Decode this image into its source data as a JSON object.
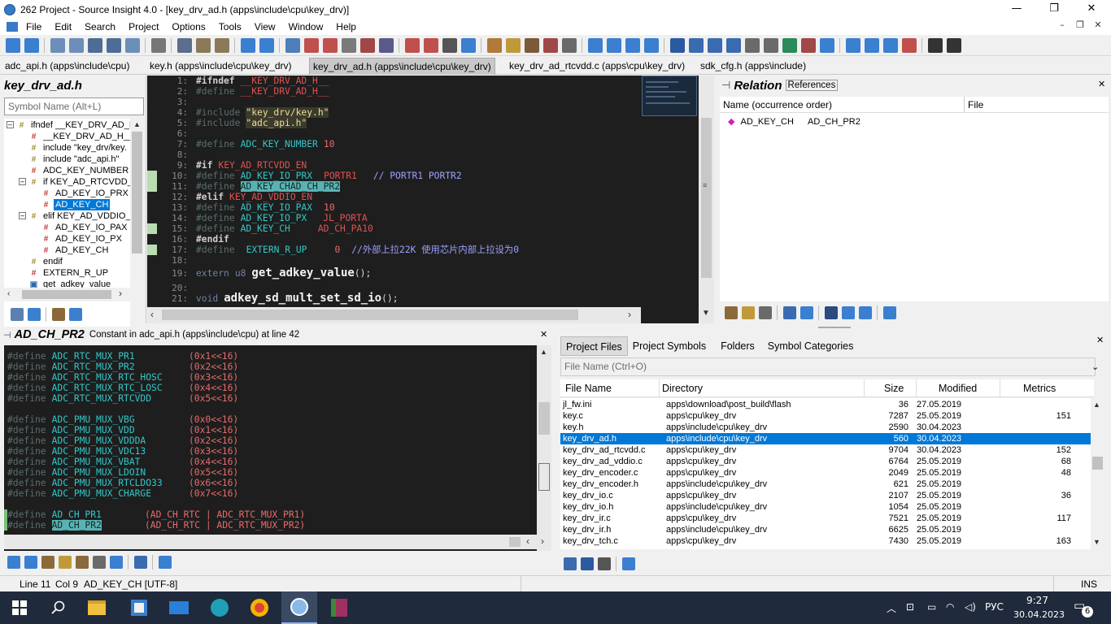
{
  "window": {
    "title": "262 Project - Source Insight 4.0 - [key_drv_ad.h (apps\\include\\cpu\\key_drv)]"
  },
  "menu": [
    "File",
    "Edit",
    "Search",
    "Project",
    "Options",
    "Tools",
    "View",
    "Window",
    "Help"
  ],
  "tabs": [
    "adc_api.h (apps\\include\\cpu)",
    "key.h (apps\\include\\cpu\\key_drv)",
    "key_drv_ad.h (apps\\include\\cpu\\key_drv)",
    "key_drv_ad_rtcvdd.c (apps\\cpu\\key_drv)",
    "sdk_cfg.h (apps\\include)"
  ],
  "symbol_window": {
    "title": "key_drv_ad.h",
    "search_placeholder": "Symbol Name (Alt+L)",
    "items": [
      "ifndef __KEY_DRV_AD_H",
      "__KEY_DRV_AD_H__",
      "include \"key_drv/key.",
      "include \"adc_api.h\"",
      "ADC_KEY_NUMBER",
      "if KEY_AD_RTCVDD_E",
      "AD_KEY_IO_PRX",
      "AD_KEY_CH",
      "elif KEY_AD_VDDIO_E",
      "AD_KEY_IO_PAX",
      "AD_KEY_IO_PX",
      "AD_KEY_CH",
      "endif",
      "EXTERN_R_UP",
      "get_adkey_value"
    ]
  },
  "editor": {
    "line_numbers": [
      "1:",
      "2:",
      "3:",
      "4:",
      "5:",
      "6:",
      "7:",
      "8:",
      "9:",
      "10:",
      "11:",
      "12:",
      "13:",
      "14:",
      "15:",
      "16:",
      "17:",
      "18:",
      "19:",
      "20:",
      "21:"
    ],
    "l1a": "#ifndef",
    "l1b": "__KEY_DRV_AD_H__",
    "l2a": "#define",
    "l2b": "__KEY_DRV_AD_H__",
    "l4a": "#include",
    "l4b": "\"key_drv/key.h\"",
    "l5a": "#include",
    "l5b": "\"adc_api.h\"",
    "l7a": "#define",
    "l7b": "ADC_KEY_NUMBER",
    "l7c": "10",
    "l9a": "#if",
    "l9b": "KEY_AD_RTCVDD_EN",
    "l10a": "#define",
    "l10b": "AD_KEY_IO_PRX",
    "l10c": "PORTR1",
    "l10d": "// PORTR1 PORTR2",
    "l11a": "#define",
    "l11b": "AD_KEY_CH",
    "l11c": "AD_CH_PR2",
    "l12a": "#elif",
    "l12b": "KEY_AD_VDDIO_EN",
    "l13a": "#define",
    "l13b": "AD_KEY_IO_PAX",
    "l13c": "10",
    "l14a": "#define",
    "l14b": "AD_KEY_IO_PX",
    "l14c": "JL_PORTA",
    "l15a": "#define",
    "l15b": "AD_KEY_CH",
    "l15c": "AD_CH_PA10",
    "l16a": "#endif",
    "l17a": "#define",
    "l17b": "EXTERN_R_UP",
    "l17c": "0",
    "l17d": "//外部上拉22K 使用芯片内部上拉设为0",
    "l19a": "extern",
    "l19b": "u8",
    "l19c": "get_adkey_value",
    "l19d": "();",
    "l21a": "void",
    "l21b": "adkey_sd_mult_set_sd_io",
    "l21c": "();"
  },
  "relation": {
    "title": "Relation",
    "tab": "References",
    "col_name": "Name (occurrence order)",
    "col_file": "File",
    "row_name": "AD_KEY_CH",
    "row_ref": "AD_CH_PR2"
  },
  "context": {
    "symbol": "AD_CH_PR2",
    "desc": "Constant in adc_api.h (apps\\include\\cpu) at line 42",
    "rows": [
      {
        "d": "#define",
        "n": "ADC_RTC_MUX_PR1",
        "v": "(0x1<<16)"
      },
      {
        "d": "#define",
        "n": "ADC_RTC_MUX_PR2",
        "v": "(0x2<<16)"
      },
      {
        "d": "#define",
        "n": "ADC_RTC_MUX_RTC_HOSC",
        "v": "(0x3<<16)"
      },
      {
        "d": "#define",
        "n": "ADC_RTC_MUX_RTC_LOSC",
        "v": "(0x4<<16)"
      },
      {
        "d": "#define",
        "n": "ADC_RTC_MUX_RTCVDD",
        "v": "(0x5<<16)"
      },
      {
        "d": "#define",
        "n": "ADC_PMU_MUX_VBG",
        "v": "(0x0<<16)"
      },
      {
        "d": "#define",
        "n": "ADC_PMU_MUX_VDD",
        "v": "(0x1<<16)"
      },
      {
        "d": "#define",
        "n": "ADC_PMU_MUX_VDDDA",
        "v": "(0x2<<16)"
      },
      {
        "d": "#define",
        "n": "ADC_PMU_MUX_VDC13",
        "v": "(0x3<<16)"
      },
      {
        "d": "#define",
        "n": "ADC_PMU_MUX_VBAT",
        "v": "(0x4<<16)"
      },
      {
        "d": "#define",
        "n": "ADC_PMU_MUX_LDOIN",
        "v": "(0x5<<16)"
      },
      {
        "d": "#define",
        "n": "ADC_PMU_MUX_RTCLDO33",
        "v": "(0x6<<16)"
      },
      {
        "d": "#define",
        "n": "ADC_PMU_MUX_CHARGE",
        "v": "(0x7<<16)"
      },
      {
        "d": "#define",
        "n": "AD_CH_PR1",
        "v": "(AD_CH_RTC | ADC_RTC_MUX_PR1)"
      },
      {
        "d": "#define",
        "n": "AD_CH_PR2",
        "v": "(AD_CH_RTC | ADC_RTC_MUX_PR2)"
      }
    ]
  },
  "project": {
    "tabs": [
      "Project Files",
      "Project Symbols",
      "Folders",
      "Symbol Categories"
    ],
    "search_placeholder": "File Name (Ctrl+O)",
    "columns": [
      "File Name",
      "Directory",
      "Size",
      "Modified",
      "Metrics"
    ],
    "files": [
      [
        "jl_fw.ini",
        "apps\\download\\post_build\\flash",
        "36",
        "27.05.2019",
        ""
      ],
      [
        "key.c",
        "apps\\cpu\\key_drv",
        "7287",
        "25.05.2019",
        "151"
      ],
      [
        "key.h",
        "apps\\include\\cpu\\key_drv",
        "2590",
        "30.04.2023",
        ""
      ],
      [
        "key_drv_ad.h",
        "apps\\include\\cpu\\key_drv",
        "560",
        "30.04.2023",
        ""
      ],
      [
        "key_drv_ad_rtcvdd.c",
        "apps\\cpu\\key_drv",
        "9704",
        "30.04.2023",
        "152"
      ],
      [
        "key_drv_ad_vddio.c",
        "apps\\cpu\\key_drv",
        "6764",
        "25.05.2019",
        "68"
      ],
      [
        "key_drv_encoder.c",
        "apps\\cpu\\key_drv",
        "2049",
        "25.05.2019",
        "48"
      ],
      [
        "key_drv_encoder.h",
        "apps\\include\\cpu\\key_drv",
        "621",
        "25.05.2019",
        ""
      ],
      [
        "key_drv_io.c",
        "apps\\cpu\\key_drv",
        "2107",
        "25.05.2019",
        "36"
      ],
      [
        "key_drv_io.h",
        "apps\\include\\cpu\\key_drv",
        "1054",
        "25.05.2019",
        ""
      ],
      [
        "key_drv_ir.c",
        "apps\\cpu\\key_drv",
        "7521",
        "25.05.2019",
        "117"
      ],
      [
        "key_drv_ir.h",
        "apps\\include\\cpu\\key_drv",
        "6625",
        "25.05.2019",
        ""
      ],
      [
        "key_drv_tch.c",
        "apps\\cpu\\key_drv",
        "7430",
        "25.05.2019",
        "163"
      ]
    ]
  },
  "status": {
    "line": "Line 11",
    "col": "Col 9",
    "symbol": "AD_KEY_CH [UTF-8]",
    "mode": "INS"
  },
  "taskbar": {
    "lang": "РУС",
    "time": "9:27",
    "date": "30.04.2023",
    "notif": "6"
  },
  "colors": {
    "accent": "#0078d7",
    "editor_bg": "#1e1e1e",
    "macro": "#33c7c7",
    "highlight": "#5bb2b2"
  }
}
